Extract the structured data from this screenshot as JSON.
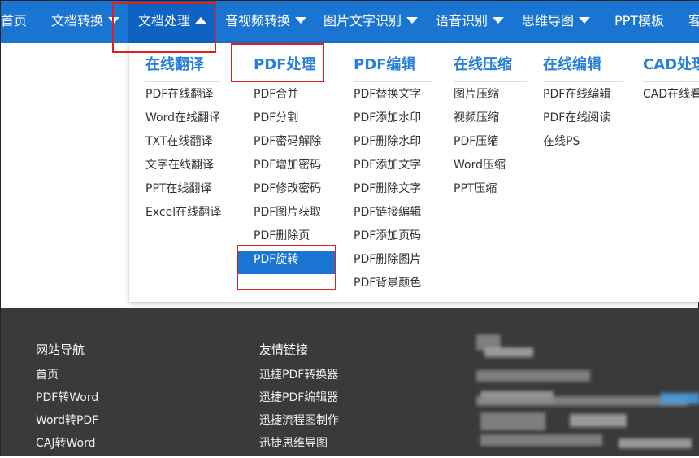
{
  "nav": {
    "items": [
      {
        "label": "首页",
        "has_caret": false
      },
      {
        "label": "文档转换",
        "has_caret": true
      },
      {
        "label": "文档处理",
        "has_caret": true,
        "active": true
      },
      {
        "label": "音视频转换",
        "has_caret": true
      },
      {
        "label": "图片文字识别",
        "has_caret": true
      },
      {
        "label": "语音识别",
        "has_caret": true
      },
      {
        "label": "思维导图",
        "has_caret": true
      },
      {
        "label": "PPT模板",
        "has_caret": false
      },
      {
        "label": "客",
        "has_caret": false
      }
    ]
  },
  "dropdown": {
    "columns": [
      {
        "title": "在线翻译",
        "items": [
          "PDF在线翻译",
          "Word在线翻译",
          "TXT在线翻译",
          "文字在线翻译",
          "PPT在线翻译",
          "Excel在线翻译"
        ]
      },
      {
        "title": "PDF处理",
        "items": [
          "PDF合并",
          "PDF分割",
          "PDF密码解除",
          "PDF增加密码",
          "PDF修改密码",
          "PDF图片获取",
          "PDF删除页",
          "PDF旋转"
        ],
        "selected": "PDF旋转"
      },
      {
        "title": "PDF编辑",
        "items": [
          "PDF替换文字",
          "PDF添加水印",
          "PDF删除水印",
          "PDF添加文字",
          "PDF删除文字",
          "PDF链接编辑",
          "PDF添加页码",
          "PDF删除图片",
          "PDF背景颜色"
        ]
      },
      {
        "title": "在线压缩",
        "items": [
          "图片压缩",
          "视频压缩",
          "PDF压缩",
          "Word压缩",
          "PPT压缩"
        ]
      },
      {
        "title": "在线编辑",
        "items": [
          "PDF在线编辑",
          "PDF在线阅读",
          "在线PS"
        ]
      },
      {
        "title": "CAD处理",
        "items": [
          "CAD在线看"
        ]
      }
    ]
  },
  "footer": {
    "nav_title": "网站导航",
    "nav_links": [
      "首页",
      "PDF转Word",
      "Word转PDF",
      "CAJ转Word"
    ],
    "friends_title": "友情链接",
    "friend_links": [
      "迅捷PDF转换器",
      "迅捷PDF编辑器",
      "迅捷流程图制作",
      "迅捷思维导图"
    ]
  },
  "colors": {
    "nav_bg": "#1a74d1",
    "nav_active_bg": "#0e62c4",
    "column_title": "#2a7fd6",
    "highlight_border": "#e02020",
    "footer_bg": "#3a3a3a"
  }
}
